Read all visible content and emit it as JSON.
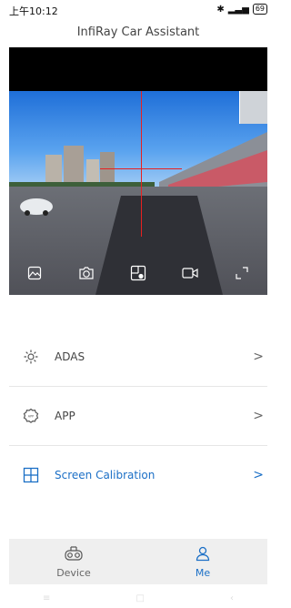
{
  "status": {
    "time": "上午10:12",
    "battery": "69"
  },
  "app": {
    "title": "InfiRay Car Assistant"
  },
  "toolbar": {
    "buttons": [
      {
        "icon": "gallery-icon"
      },
      {
        "icon": "camera-icon"
      },
      {
        "icon": "thermal-view-icon"
      },
      {
        "icon": "video-record-icon"
      },
      {
        "icon": "fullscreen-icon"
      }
    ]
  },
  "menu": {
    "items": [
      {
        "label": "ADAS",
        "icon": "gear-icon"
      },
      {
        "label": "APP",
        "icon": "app-settings-icon"
      },
      {
        "label": "Screen Calibration",
        "icon": "calibration-icon"
      }
    ],
    "chevron": ">"
  },
  "bottom_nav": {
    "items": [
      {
        "label": "Device",
        "icon": "device-icon"
      },
      {
        "label": "Me",
        "icon": "person-icon"
      }
    ]
  },
  "colors": {
    "accent": "#1b6fc6",
    "crosshair": "#e82020"
  }
}
